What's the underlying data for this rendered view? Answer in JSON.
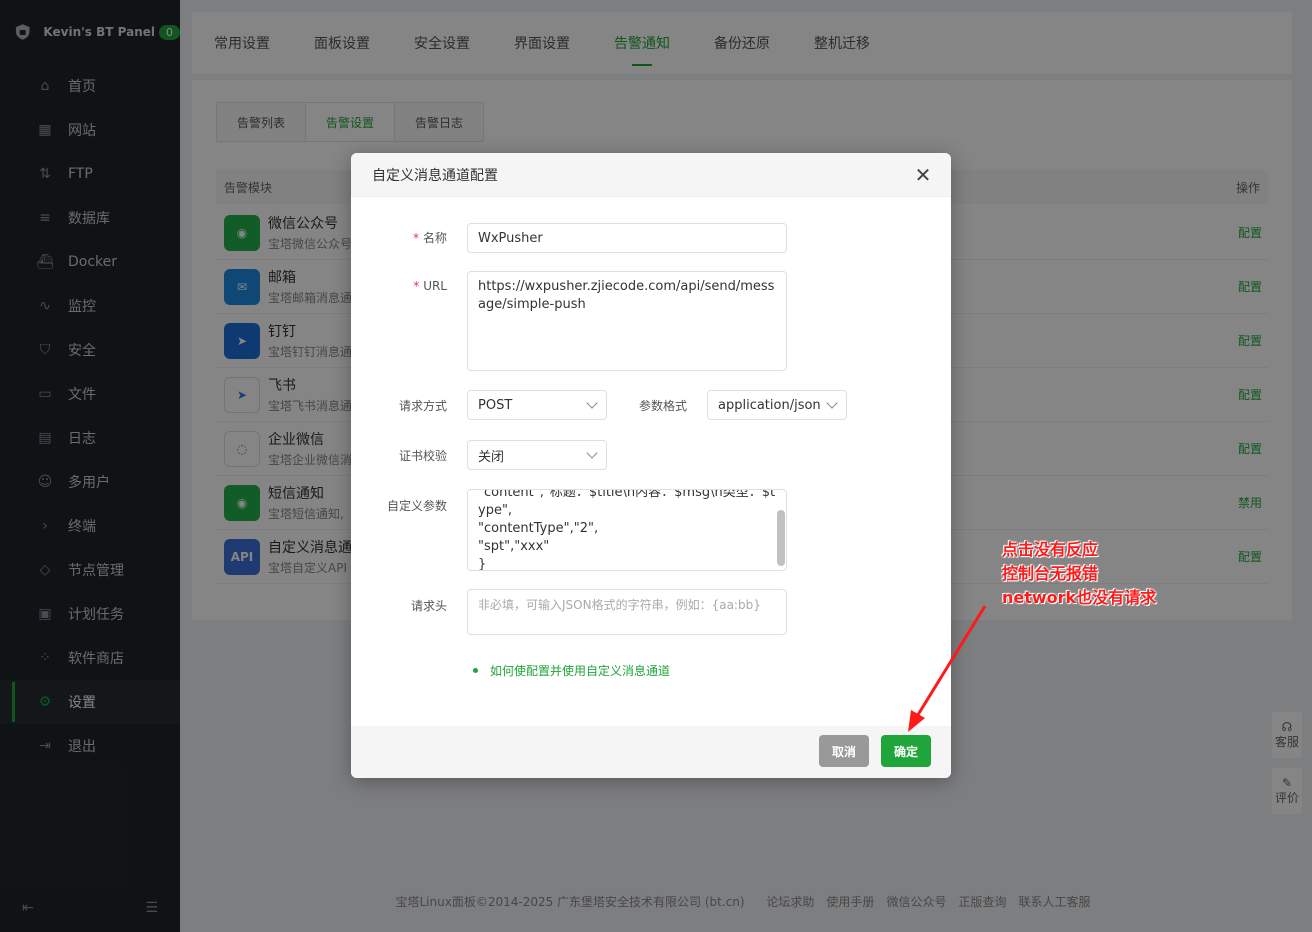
{
  "sidebar": {
    "brand": "Kevin's BT Panel",
    "badge": "0",
    "items": [
      {
        "label": "首页",
        "icon": "home-icon"
      },
      {
        "label": "网站",
        "icon": "website-icon"
      },
      {
        "label": "FTP",
        "icon": "ftp-icon"
      },
      {
        "label": "数据库",
        "icon": "database-icon"
      },
      {
        "label": "Docker",
        "icon": "docker-icon"
      },
      {
        "label": "监控",
        "icon": "monitor-icon"
      },
      {
        "label": "安全",
        "icon": "shield-icon"
      },
      {
        "label": "文件",
        "icon": "folder-icon"
      },
      {
        "label": "日志",
        "icon": "log-icon"
      },
      {
        "label": "多用户",
        "icon": "users-icon"
      },
      {
        "label": "终端",
        "icon": "terminal-icon"
      },
      {
        "label": "节点管理",
        "icon": "node-icon"
      },
      {
        "label": "计划任务",
        "icon": "calendar-icon"
      },
      {
        "label": "软件商店",
        "icon": "store-icon"
      },
      {
        "label": "设置",
        "icon": "gear-icon"
      },
      {
        "label": "退出",
        "icon": "logout-icon"
      }
    ],
    "active_index": 14
  },
  "top_tabs": [
    "常用设置",
    "面板设置",
    "安全设置",
    "界面设置",
    "告警通知",
    "备份还原",
    "整机迁移"
  ],
  "top_tabs_active": 4,
  "sub_tabs": [
    "告警列表",
    "告警设置",
    "告警日志"
  ],
  "sub_tabs_active": 1,
  "table": {
    "col_module": "告警模块",
    "col_action": "操作",
    "rows": [
      {
        "title": "微信公众号",
        "desc": "宝塔微信公众号",
        "action": "配置",
        "color": "#22b14c",
        "glyph": "◉"
      },
      {
        "title": "邮箱",
        "desc": "宝塔邮箱消息通",
        "action": "配置",
        "color": "#1e88e5",
        "glyph": "✉"
      },
      {
        "title": "钉钉",
        "desc": "宝塔钉钉消息通",
        "action": "配置",
        "color": "#1e6fd9",
        "glyph": "➤"
      },
      {
        "title": "飞书",
        "desc": "宝塔飞书消息通",
        "action": "配置",
        "color": "#ffffff",
        "glyph": "➤"
      },
      {
        "title": "企业微信",
        "desc": "宝塔企业微信消",
        "action": "配置",
        "color": "#ffffff",
        "glyph": "◌"
      },
      {
        "title": "短信通知",
        "desc": "宝塔短信通知,",
        "action": "禁用",
        "color": "#22b14c",
        "glyph": "◉"
      },
      {
        "title": "自定义消息通",
        "desc": "宝塔自定义API",
        "action": "配置",
        "color": "#3b6fd6",
        "glyph": "API"
      }
    ]
  },
  "footer": {
    "copyright": "宝塔Linux面板©2014-2025 广东堡塔安全技术有限公司 (bt.cn)",
    "links": [
      "论坛求助",
      "使用手册",
      "微信公众号",
      "正版查询",
      "联系人工客服"
    ]
  },
  "float_buttons": [
    "客服",
    "评价"
  ],
  "modal": {
    "title": "自定义消息通道配置",
    "name_label": "名称",
    "name_value": "WxPusher",
    "url_label": "URL",
    "url_value": "https://wxpusher.zjiecode.com/api/send/message/simple-push",
    "method_label": "请求方式",
    "method_value": "POST",
    "format_label": "参数格式",
    "format_value": "application/json",
    "cert_label": "证书校验",
    "cert_value": "关闭",
    "params_label": "自定义参数",
    "params_value": "\"content\",\"标题：$title\\n内容：$msg\\n类型：$type\",\n\"contentType\",\"2\",\n\"spt\",\"xxx\"\n}",
    "headers_label": "请求头",
    "headers_placeholder": "非必填，可输入JSON格式的字符串，例如：{aa:bb}",
    "help_link": "如何使配置并使用自定义消息通道",
    "cancel": "取消",
    "ok": "确定"
  },
  "annotation": {
    "line1": "点击没有反应",
    "line2": "控制台无报错",
    "line3": "network也没有请求",
    "color": "#ff1a1a"
  }
}
